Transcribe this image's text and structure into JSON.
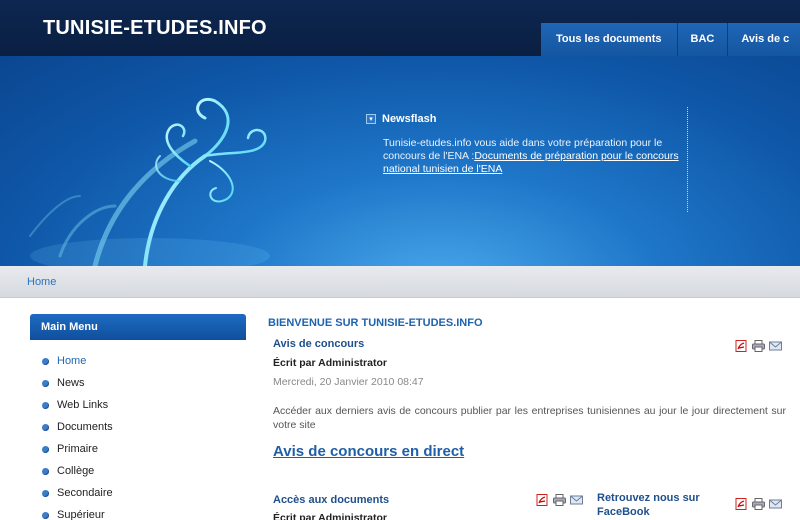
{
  "site": {
    "title": "TUNISIE-ETUDES.INFO"
  },
  "nav": [
    "Tous les documents",
    "BAC",
    "Avis de c"
  ],
  "newsflash": {
    "title": "Newsflash",
    "text": "Tunisie-etudes.info vous aide dans votre préparation pour le concours de l'ENA :",
    "link": "Documents de préparation pour le concours national tunisien de l'ENA"
  },
  "breadcrumb": "Home",
  "sidebar": {
    "title": "Main Menu",
    "items": [
      "Home",
      "News",
      "Web Links",
      "Documents",
      "Primaire",
      "Collège",
      "Secondaire",
      "Supérieur"
    ]
  },
  "main": {
    "heading": "BIENVENUE SUR TUNISIE-ETUDES.INFO",
    "article1": {
      "title": "Avis de concours",
      "author": "Écrit par Administrator",
      "date": "Mercredi, 20 Janvier 2010 08:47",
      "text": "Accéder aux derniers avis de concours publier par les entreprises tunisiennes au jour le jour directement sur votre site",
      "link": "Avis de concours en direct"
    },
    "article2": {
      "title": "Accès aux documents",
      "author": "Écrit par Administrator"
    },
    "article3": {
      "title": "Retrouvez nous sur FaceBook"
    }
  },
  "colors": {
    "header": "#0d2750",
    "nav": "#1f66b6",
    "link": "#1f5fa8"
  }
}
